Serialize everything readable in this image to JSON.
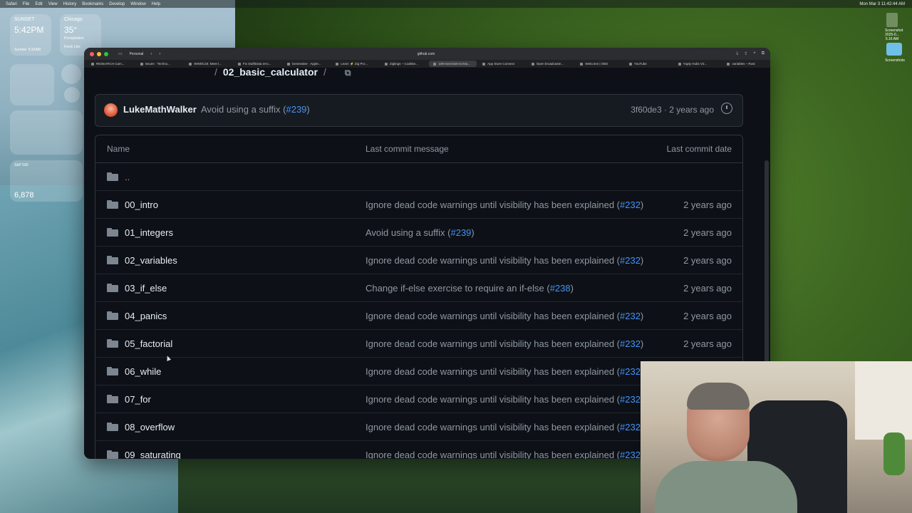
{
  "menubar": {
    "items": [
      "Safari",
      "File",
      "Edit",
      "View",
      "History",
      "Bookmarks",
      "Develop",
      "Window",
      "Help"
    ],
    "clock": "Mon Mar 3  11:42:44 AM"
  },
  "widgets": {
    "sunset_label": "SUNSET",
    "sunset_time": "5:42PM",
    "sunrise": "Sunrise: 6:32AM",
    "weather_city": "Chicago",
    "weather_temp": "35°",
    "weather_cond": "Precipitation",
    "weather_extra": "Feels Like",
    "stock_name": "S&P 500",
    "stock_value": "6,878"
  },
  "desktop": {
    "icon_label": "Screenshot 2025-0... 5.16 AM",
    "folder_label": "Screenshots"
  },
  "browser": {
    "profile": "Personal",
    "address": "github.com",
    "tabs": [
      {
        "label": "RESEARCH Cam..."
      },
      {
        "label": "Issues · Techno..."
      },
      {
        "label": "WWDC25: Meet t..."
      },
      {
        "label": "Fix SwiftData erro..."
      },
      {
        "label": "Generative · Apple..."
      },
      {
        "label": "Learn ⚡ Zig Pro..."
      },
      {
        "label": "Ziglings – Codebe..."
      },
      {
        "label": "100-exercises-to-lea..."
      },
      {
        "label": "App Store Connect"
      },
      {
        "label": "Open broadcaste..."
      },
      {
        "label": "Welcome | OBS"
      },
      {
        "label": "YouTube"
      },
      {
        "label": "Yupty Hubs V2..."
      },
      {
        "label": "variables – Rust"
      }
    ]
  },
  "repo": {
    "breadcrumb_current": "02_basic_calculator",
    "commit_author": "LukeMathWalker",
    "commit_message": "Avoid using a suffix (",
    "commit_pr": "#239",
    "commit_close": ")",
    "commit_sha_date": "3f60de3 · 2 years ago"
  },
  "table": {
    "headers": {
      "name": "Name",
      "message": "Last commit message",
      "date": "Last commit date"
    },
    "parent": "..",
    "rows": [
      {
        "name": "00_intro",
        "msg": "Ignore dead code warnings until visibility has been explained (",
        "pr": "#232",
        "date": "2 years ago"
      },
      {
        "name": "01_integers",
        "msg": "Avoid using a suffix (",
        "pr": "#239",
        "date": "2 years ago"
      },
      {
        "name": "02_variables",
        "msg": "Ignore dead code warnings until visibility has been explained (",
        "pr": "#232",
        "date": "2 years ago"
      },
      {
        "name": "03_if_else",
        "msg": "Change if-else exercise to require an if-else (",
        "pr": "#238",
        "date": "2 years ago"
      },
      {
        "name": "04_panics",
        "msg": "Ignore dead code warnings until visibility has been explained (",
        "pr": "#232",
        "date": "2 years ago"
      },
      {
        "name": "05_factorial",
        "msg": "Ignore dead code warnings until visibility has been explained (",
        "pr": "#232",
        "date": "2 years ago"
      },
      {
        "name": "06_while",
        "msg": "Ignore dead code warnings until visibility has been explained (",
        "pr": "#232",
        "date": ""
      },
      {
        "name": "07_for",
        "msg": "Ignore dead code warnings until visibility has been explained (",
        "pr": "#232",
        "date": ""
      },
      {
        "name": "08_overflow",
        "msg": "Ignore dead code warnings until visibility has been explained (",
        "pr": "#232",
        "date": ""
      },
      {
        "name": "09_saturating",
        "msg": "Ignore dead code warnings until visibility has been explained (",
        "pr": "#232",
        "date": ""
      }
    ]
  },
  "colors": {
    "bg": "#0d1117",
    "link": "#4493f8",
    "muted": "#9198a1",
    "text": "#e6edf3"
  }
}
